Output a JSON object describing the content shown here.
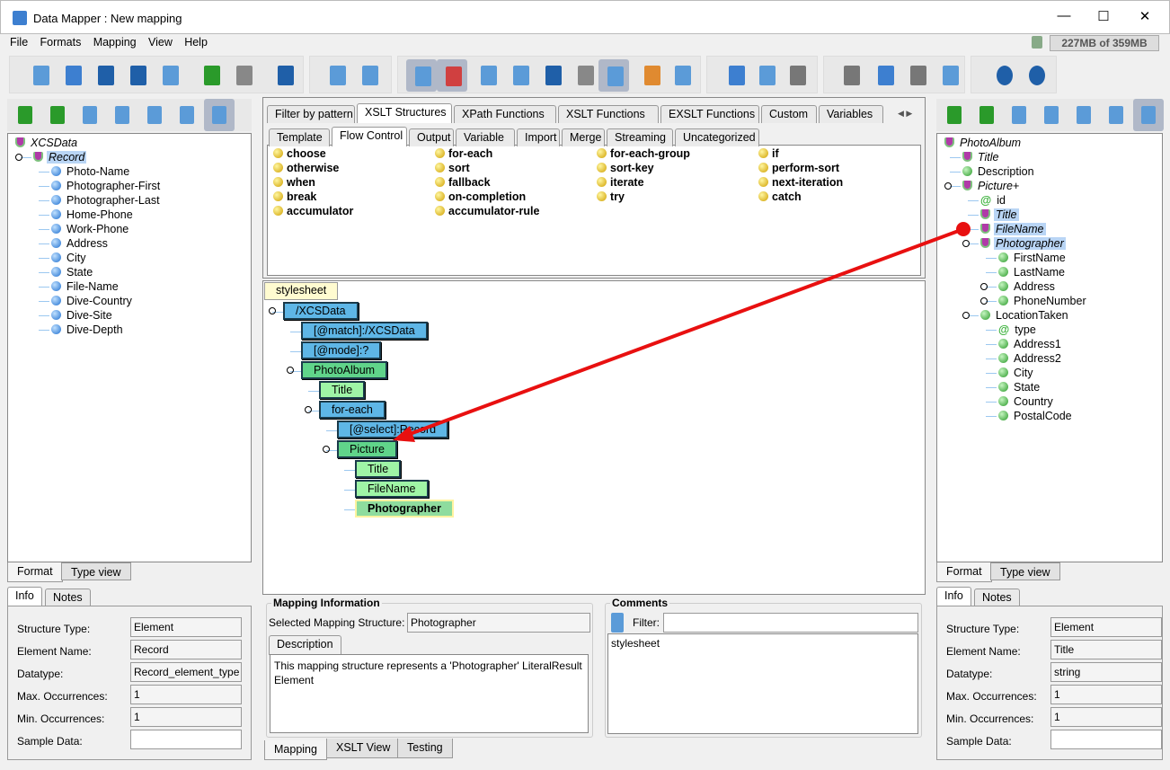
{
  "window": {
    "title": "Data Mapper : New mapping",
    "minimize": "—",
    "maximize": "☐",
    "close": "✕"
  },
  "menu": [
    "File",
    "Formats",
    "Mapping",
    "View",
    "Help"
  ],
  "memory": "227MB of 359MB",
  "colors": {
    "schema_blue": "#5eb6e6",
    "schema_green": "#60d48a",
    "schema_light_green": "#9ff5a6",
    "mapping_arrow": "#e81010",
    "selection": "#b9d5f5"
  },
  "main_toolbar_icons": [
    "new-mapping-icon",
    "open-icon",
    "save-icon",
    "save-as-icon",
    "export-xls-icon",
    "undo-icon",
    "redo-icon",
    "exit-icon",
    "new-structure-icon",
    "structure-settings-icon",
    "view-info-icon",
    "view-colors-icon",
    "checklist-icon",
    "xml-source-icon",
    "save-schedule-icon",
    "document-icon",
    "attribute-icon",
    "table-icon",
    "database-icon",
    "cut-icon",
    "copy-icon",
    "paste-icon",
    "move-left-icon",
    "move-up-icon",
    "move-right-icon",
    "list-icon",
    "help-icon",
    "about-icon"
  ],
  "source": {
    "toolbar_icons": [
      "import-icon",
      "find-replace-icon",
      "notes-icon",
      "structure-icon",
      "inspect-icon",
      "edit-icon",
      "select-mode-icon"
    ],
    "tree": [
      {
        "label": "XCSData",
        "level": 0,
        "icon": "shield",
        "italic": true
      },
      {
        "label": "Record",
        "level": 1,
        "icon": "shield",
        "italic": true,
        "expander": true,
        "selected": true
      },
      {
        "label": "Photo-Name",
        "level": 2,
        "icon": "blue"
      },
      {
        "label": "Photographer-First",
        "level": 2,
        "icon": "blue"
      },
      {
        "label": "Photographer-Last",
        "level": 2,
        "icon": "blue"
      },
      {
        "label": "Home-Phone",
        "level": 2,
        "icon": "blue"
      },
      {
        "label": "Work-Phone",
        "level": 2,
        "icon": "blue"
      },
      {
        "label": "Address",
        "level": 2,
        "icon": "blue"
      },
      {
        "label": "City",
        "level": 2,
        "icon": "blue"
      },
      {
        "label": "State",
        "level": 2,
        "icon": "blue"
      },
      {
        "label": "File-Name",
        "level": 2,
        "icon": "blue"
      },
      {
        "label": "Dive-Country",
        "level": 2,
        "icon": "blue"
      },
      {
        "label": "Dive-Site",
        "level": 2,
        "icon": "blue"
      },
      {
        "label": "Dive-Depth",
        "level": 2,
        "icon": "blue"
      }
    ],
    "view_tabs": [
      "Format",
      "Type view"
    ],
    "info_tabs": [
      "Info",
      "Notes"
    ],
    "info": [
      {
        "label": "Structure Type:",
        "value": "Element"
      },
      {
        "label": "Element Name:",
        "value": "Record"
      },
      {
        "label": "Datatype:",
        "value": "Record_element_type"
      },
      {
        "label": "Max. Occurrences:",
        "value": "1"
      },
      {
        "label": "Min. Occurrences:",
        "value": "1"
      },
      {
        "label": "Sample Data:",
        "value": ""
      }
    ]
  },
  "target": {
    "toolbar_icons": [
      "export-icon",
      "find-replace-icon",
      "notes-icon",
      "structure-icon",
      "inspect-icon",
      "edit-icon",
      "select-mode-icon"
    ],
    "tree": [
      {
        "label": "PhotoAlbum",
        "level": 0,
        "icon": "shield",
        "italic": true
      },
      {
        "label": "Title",
        "level": 1,
        "icon": "shield",
        "italic": true
      },
      {
        "label": "Description",
        "level": 1,
        "icon": "green"
      },
      {
        "label": "Picture+",
        "level": 1,
        "icon": "shield",
        "italic": true,
        "expander": true
      },
      {
        "label": "id",
        "level": 2,
        "icon": "at"
      },
      {
        "label": "Title",
        "level": 2,
        "icon": "shield",
        "italic": true,
        "selected": true
      },
      {
        "label": "FileName",
        "level": 2,
        "icon": "shield",
        "italic": true,
        "selected": true
      },
      {
        "label": "Photographer",
        "level": 2,
        "icon": "shield",
        "italic": true,
        "selected": true,
        "expander": true
      },
      {
        "label": "FirstName",
        "level": 3,
        "icon": "green"
      },
      {
        "label": "LastName",
        "level": 3,
        "icon": "green"
      },
      {
        "label": "Address",
        "level": 3,
        "icon": "green",
        "collapsed": true
      },
      {
        "label": "PhoneNumber",
        "level": 3,
        "icon": "green",
        "collapsed": true
      },
      {
        "label": "LocationTaken",
        "level": 2,
        "icon": "green",
        "expander": true
      },
      {
        "label": "type",
        "level": 3,
        "icon": "at"
      },
      {
        "label": "Address1",
        "level": 3,
        "icon": "green"
      },
      {
        "label": "Address2",
        "level": 3,
        "icon": "green"
      },
      {
        "label": "City",
        "level": 3,
        "icon": "green"
      },
      {
        "label": "State",
        "level": 3,
        "icon": "green"
      },
      {
        "label": "Country",
        "level": 3,
        "icon": "green"
      },
      {
        "label": "PostalCode",
        "level": 3,
        "icon": "green"
      }
    ],
    "view_tabs": [
      "Format",
      "Type view"
    ],
    "info_tabs": [
      "Info",
      "Notes"
    ],
    "info": [
      {
        "label": "Structure Type:",
        "value": "Element"
      },
      {
        "label": "Element Name:",
        "value": "Title"
      },
      {
        "label": "Datatype:",
        "value": "string"
      },
      {
        "label": "Max. Occurrences:",
        "value": "1"
      },
      {
        "label": "Min. Occurrences:",
        "value": "1"
      },
      {
        "label": "Sample Data:",
        "value": ""
      }
    ]
  },
  "palette": {
    "tabs": [
      "Filter by pattern",
      "XSLT Structures",
      "XPath Functions",
      "XSLT Functions",
      "EXSLT Functions",
      "Custom",
      "Variables"
    ],
    "active_tab": "XSLT Structures",
    "subtabs": [
      "Template",
      "Flow Control",
      "Output",
      "Variable",
      "Import",
      "Merge",
      "Streaming",
      "Uncategorized"
    ],
    "active_subtab": "Flow Control",
    "columns": [
      [
        "choose",
        "otherwise",
        "when",
        "break",
        "accumulator"
      ],
      [
        "for-each",
        "sort",
        "fallback",
        "on-completion",
        "accumulator-rule"
      ],
      [
        "for-each-group",
        "sort-key",
        "iterate",
        "try"
      ],
      [
        "if",
        "perform-sort",
        "next-iteration",
        "catch"
      ]
    ]
  },
  "mapping_tree": [
    {
      "label": "stylesheet",
      "level": 0,
      "kind": "root"
    },
    {
      "label": "/XCSData",
      "level": 1,
      "kind": "blue",
      "expander": true
    },
    {
      "label": "[@match]:/XCSData",
      "level": 2,
      "kind": "blue"
    },
    {
      "label": "[@mode]:?",
      "level": 2,
      "kind": "blue"
    },
    {
      "label": "PhotoAlbum",
      "level": 2,
      "kind": "green",
      "expander": true
    },
    {
      "label": "Title",
      "level": 3,
      "kind": "lgreen"
    },
    {
      "label": "for-each",
      "level": 3,
      "kind": "blue",
      "expander": true
    },
    {
      "label": "[@select]:Record",
      "level": 4,
      "kind": "blue"
    },
    {
      "label": "Picture",
      "level": 4,
      "kind": "green",
      "expander": true
    },
    {
      "label": "Title",
      "level": 5,
      "kind": "lgreen"
    },
    {
      "label": "FileName",
      "level": 5,
      "kind": "lgreen"
    },
    {
      "label": "Photographer",
      "level": 5,
      "kind": "sel"
    }
  ],
  "mapping_info": {
    "title": "Mapping Information",
    "selected_label": "Selected Mapping Structure:",
    "selected_value": "Photographer",
    "desc_tab": "Description",
    "description": "This mapping structure represents a 'Photographer' LiteralResult Element"
  },
  "comments": {
    "title": "Comments",
    "filter_label": "Filter:",
    "filter_value": "",
    "items": [
      "stylesheet"
    ]
  },
  "bottom_tabs": [
    "Mapping",
    "XSLT View",
    "Testing"
  ],
  "active_bottom_tab": "Mapping"
}
